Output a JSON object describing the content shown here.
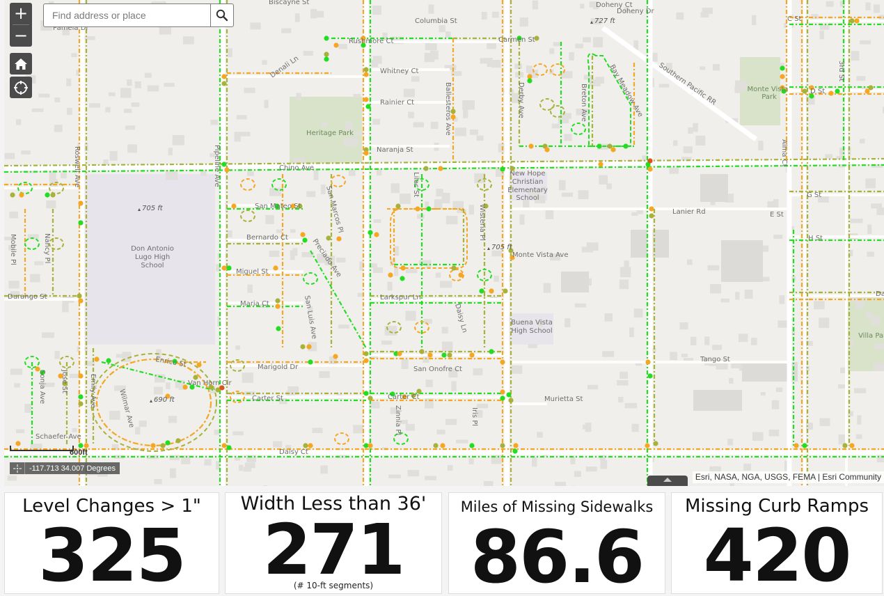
{
  "map": {
    "search": {
      "placeholder": "Find address or place",
      "value": ""
    },
    "controls": {
      "zoom_in": "+",
      "zoom_out": "−",
      "home_icon": "home-icon",
      "locate_icon": "locate-crosshair-icon",
      "search_icon": "search-icon"
    },
    "scale_label": "600ft",
    "coordinates": "-117.713 34.007 Degrees",
    "attribution": "Esri, NASA, NGA, USGS, FEMA | Esri Community",
    "legend_colors": {
      "good": "#22dd22",
      "fair": "#a8b23a",
      "warning": "#f5a623",
      "poor": "#d9541e"
    },
    "street_labels": [
      "Biscayne St",
      "Columbia St",
      "Rushmore Ct",
      "Carmen St",
      "Doheny Ct",
      "Doheny Dr",
      "Pamela Dr",
      "Denali Ln",
      "Whitney Ct",
      "Rainier Ct",
      "Ballesteros Ave",
      "Derby Ave",
      "Breton Ave",
      "Bay Meadow Ave",
      "Southern Pacific RR",
      "C St",
      "D St",
      "3rd St",
      "Naranja St",
      "Chino Ave",
      "Roswell Ave",
      "Pipeline Ave",
      "San Mateo St",
      "San Marcos Pl",
      "Lilac St",
      "Bernardo Ct",
      "Preciado Ave",
      "Wisteria Pl",
      "Miguel St",
      "Maria Ct",
      "San Luis Ave",
      "Larkspur Ln",
      "Daisy Ln",
      "Mobile Pl",
      "Nancy Pl",
      "Durango St",
      "Lanier Rd",
      "E St",
      "G St",
      "H St",
      "Danito Ct",
      "Monte Vista Ave",
      "Alma Ct",
      "Marigold Dr",
      "San Onofre Ct",
      "Carter St",
      "Carter Ct",
      "Murietta St",
      "Tango St",
      "Enrico St",
      "Van Horn Cir",
      "Wilmar Ave",
      "Emily Ave",
      "Sonja Ave",
      "Jose St",
      "Schaefer Ave",
      "Daisy Ct",
      "Iris Pl",
      "Zinnia Pl"
    ],
    "place_labels": [
      "Heritage Park",
      "Monte Vista Park",
      "Don Antonio Lugo High School",
      "New Hope Christian Elementary School",
      "Buena Vista High School",
      "Villa Park"
    ],
    "elevation_labels": [
      "727 ft",
      "705 ft",
      "705 ft",
      "690 ft"
    ]
  },
  "stats": [
    {
      "title": "Level Changes > 1\"",
      "value": "325",
      "subtitle": ""
    },
    {
      "title": "Width Less than 36'",
      "value": "271",
      "subtitle": "(# 10-ft segments)"
    },
    {
      "title": "Miles of Missing Sidewalks",
      "value": "86.6",
      "subtitle": ""
    },
    {
      "title": "Missing Curb Ramps",
      "value": "420",
      "subtitle": ""
    }
  ]
}
